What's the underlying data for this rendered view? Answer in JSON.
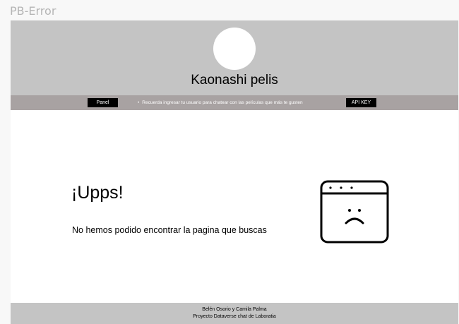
{
  "frame": {
    "label": "PB-Error"
  },
  "header": {
    "logo_icon": "avatar-circle",
    "title": "Kaonashi pelis"
  },
  "nav": {
    "panel_label": "Panel",
    "bullet": "•",
    "note": "Recuerda ingresar  tu usuario para chatear con las películas que más te gusten",
    "api_key_label": "API KEY"
  },
  "error": {
    "title": "¡Upps!",
    "message": "No hemos podido encontrar la pagina que buscas",
    "icon": "sad-browser-window-icon"
  },
  "footer": {
    "line1": "Belén Osorio y Camila Palma",
    "line2": "Proyecto Dataverse chat de Laboratia"
  },
  "colors": {
    "header_bg": "#c4c4c4",
    "nav_bg": "#a8a2a2",
    "button_bg": "#000000",
    "page_bg": "#ffffff",
    "frame_label": "#b5b5b5"
  }
}
